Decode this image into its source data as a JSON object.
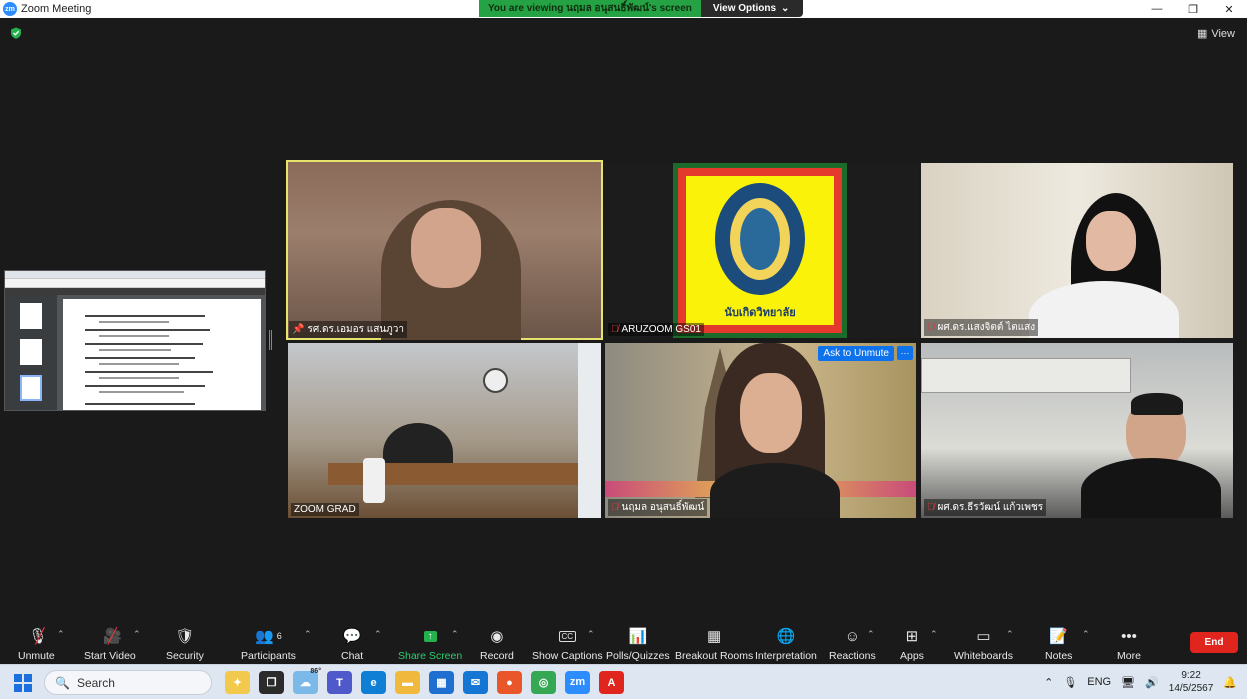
{
  "window": {
    "title": "Zoom Meeting"
  },
  "banner": {
    "text": "You are viewing นฤมล อนุสนธิ์พัฒน์'s screen",
    "button": "View Options"
  },
  "view_button": "View",
  "tiles": [
    {
      "name": "รศ.ดร.เอมอร แสนภูวา",
      "prefix_icon": "pin-icon",
      "active_speaker": true
    },
    {
      "name": "ARUZOOM GS01",
      "prefix_icon": "mic-muted-icon",
      "logo_caption": "นับเกิดวิทยาลัย"
    },
    {
      "name": "ผศ.ดร.แสงจิตต์ ไตแสง",
      "prefix_icon": "mic-muted-icon"
    },
    {
      "name": "ZOOM GRAD",
      "prefix_icon": ""
    },
    {
      "name": "นฤมล อนุสนธิ์พัฒน์",
      "prefix_icon": "mic-muted-icon",
      "ask_unmute": "Ask to Unmute"
    },
    {
      "name": "ผศ.ดร.ธีรวัฒน์ แก้วเพชร",
      "prefix_icon": "mic-muted-icon"
    }
  ],
  "toolbar": {
    "unmute": "Unmute",
    "start_video": "Start Video",
    "security": "Security",
    "participants": "Participants",
    "participants_count": "6",
    "chat": "Chat",
    "share_screen": "Share Screen",
    "record": "Record",
    "show_captions": "Show Captions",
    "polls": "Polls/Quizzes",
    "breakout": "Breakout Rooms",
    "interpretation": "Interpretation",
    "reactions": "Reactions",
    "apps": "Apps",
    "whiteboards": "Whiteboards",
    "notes": "Notes",
    "more": "More",
    "end": "End"
  },
  "taskbar": {
    "search_placeholder": "Search",
    "weather_temp": "86°",
    "language": "ENG",
    "time": "9:22",
    "date": "14/5/2567"
  },
  "colors": {
    "zoom_blue": "#0e72ed",
    "banner_green": "#25a243",
    "end_red": "#e0241e",
    "active_outline": "#e6e46a"
  }
}
